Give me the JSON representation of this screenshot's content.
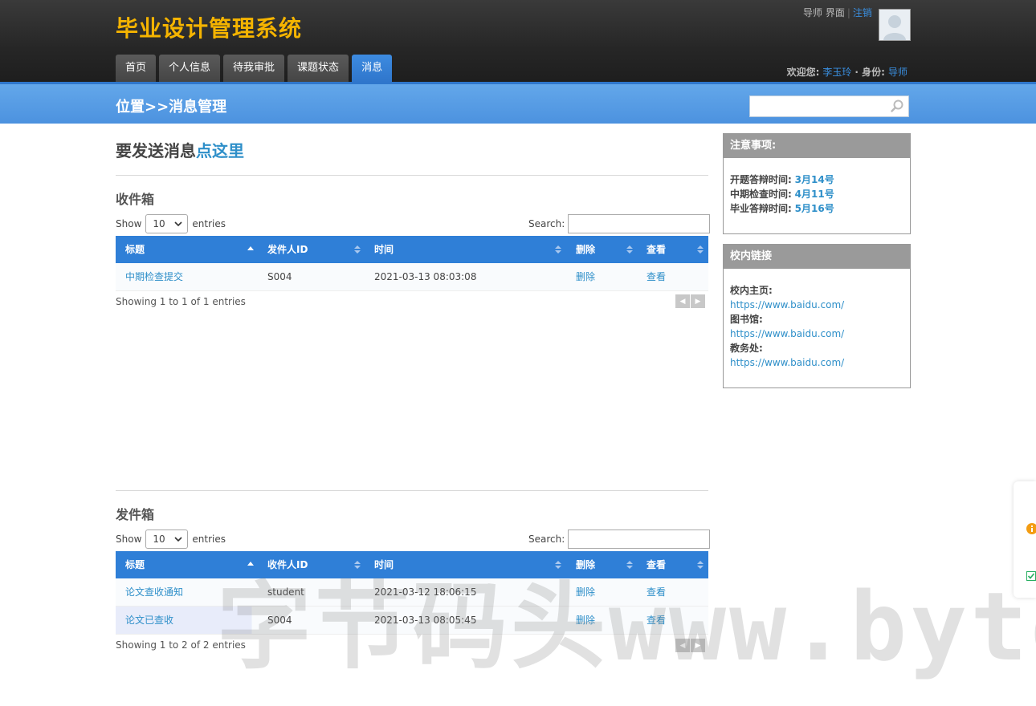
{
  "app": {
    "logo": "毕业设计管理系统"
  },
  "nav": {
    "items": [
      "首页",
      "个人信息",
      "待我审批",
      "课题状态",
      "消息"
    ],
    "active_index": 4
  },
  "top_links": {
    "role_interface": "导师 界面",
    "logout": "注销"
  },
  "welcome": {
    "welcome_label": "欢迎您:",
    "user": "李玉玲",
    "role_label": "身份:",
    "role": "导师"
  },
  "location": {
    "title": "位置>>消息管理",
    "search_placeholder": ""
  },
  "send": {
    "prefix": "要发送消息",
    "link": "点这里"
  },
  "inbox": {
    "title": "收件箱",
    "show": "Show",
    "length": "10",
    "entries": "entries",
    "search_label": "Search:",
    "columns": [
      "标题",
      "发件人ID",
      "时间",
      "删除",
      "查看"
    ],
    "rows": [
      {
        "title": "中期检查提交",
        "sender": "S004",
        "time": "2021-03-13 08:03:08",
        "delete": "删除",
        "view": "查看"
      }
    ],
    "info": "Showing 1 to 1 of 1 entries"
  },
  "outbox": {
    "title": "发件箱",
    "show": "Show",
    "length": "10",
    "entries": "entries",
    "search_label": "Search:",
    "columns": [
      "标题",
      "收件人ID",
      "时间",
      "删除",
      "查看"
    ],
    "rows": [
      {
        "title": "论文查收通知",
        "receiver": "student",
        "time": "2021-03-12 18:06:15",
        "delete": "删除",
        "view": "查看"
      },
      {
        "title": "论文已查收",
        "receiver": "S004",
        "time": "2021-03-13 08:05:45",
        "delete": "删除",
        "view": "查看"
      }
    ],
    "info": "Showing 1 to 2 of 2 entries"
  },
  "notice": {
    "title": "注意事项:",
    "items": [
      {
        "label": "开题答辩时间:",
        "value": "3月14号"
      },
      {
        "label": "中期检查时间:",
        "value": "4月11号"
      },
      {
        "label": "毕业答辩时间:",
        "value": "5月16号"
      }
    ]
  },
  "links": {
    "title": "校内链接",
    "items": [
      {
        "label": "校内主页:",
        "url": "https://www.baidu.com/"
      },
      {
        "label": "图书馆:",
        "url": "https://www.baidu.com/"
      },
      {
        "label": "教务处:",
        "url": "https://www.baidu.com/"
      }
    ]
  },
  "watermark": "字节码头www.bytes",
  "colors": {
    "logo": "#f5b400",
    "accent": "#2f7fd7",
    "link": "#2e8fc9"
  }
}
